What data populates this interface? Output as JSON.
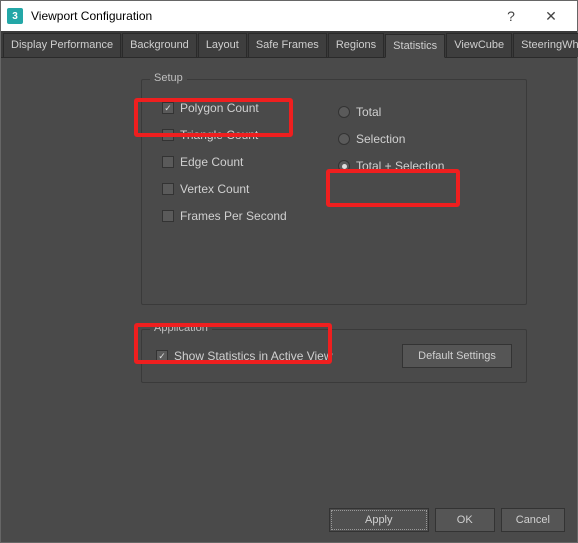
{
  "window": {
    "title": "Viewport Configuration"
  },
  "tabs": {
    "items": [
      {
        "label": "Display Performance"
      },
      {
        "label": "Background"
      },
      {
        "label": "Layout"
      },
      {
        "label": "Safe Frames"
      },
      {
        "label": "Regions"
      },
      {
        "label": "Statistics"
      },
      {
        "label": "ViewCube"
      },
      {
        "label": "SteeringWheels"
      }
    ],
    "active": "Statistics"
  },
  "setup": {
    "legend": "Setup",
    "checks": {
      "polygon": "Polygon Count",
      "triangle": "Triangle Count",
      "edge": "Edge Count",
      "vertex": "Vertex Count",
      "fps": "Frames Per Second"
    },
    "radios": {
      "total": "Total",
      "selection": "Selection",
      "both": "Total + Selection"
    }
  },
  "application": {
    "legend": "Application",
    "show_stats": "Show Statistics in Active View",
    "default_btn": "Default Settings"
  },
  "buttons": {
    "apply": "Apply",
    "ok": "OK",
    "cancel": "Cancel"
  }
}
